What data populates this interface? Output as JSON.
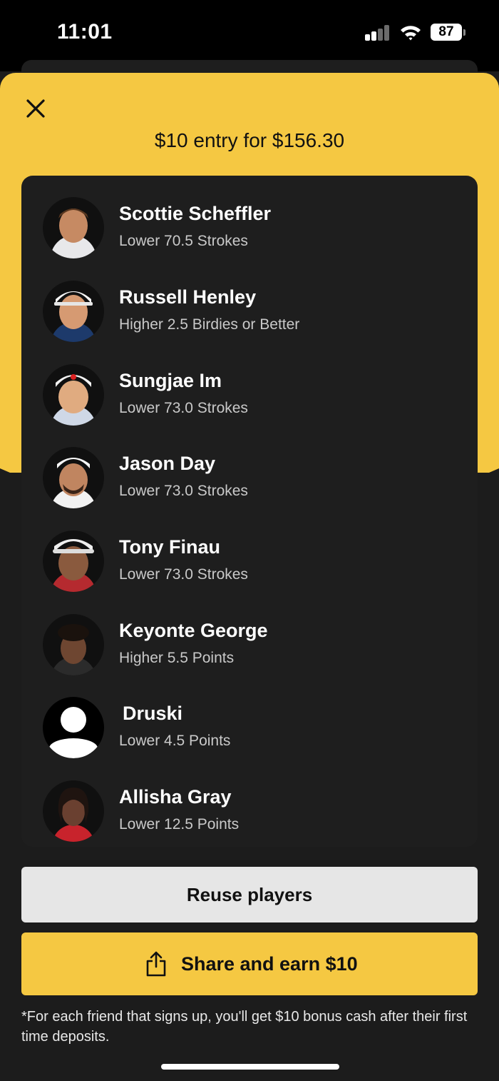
{
  "status_bar": {
    "time": "11:01",
    "battery": "87"
  },
  "sheet": {
    "title": "$10 entry for $156.30"
  },
  "picks": [
    {
      "player": "Scottie Scheffler",
      "line": "Lower 70.5 Strokes",
      "avatar_icon": "player-photo-icon"
    },
    {
      "player": "Russell Henley",
      "line": "Higher 2.5 Birdies or Better",
      "avatar_icon": "player-photo-icon"
    },
    {
      "player": "Sungjae Im",
      "line": "Lower 73.0 Strokes",
      "avatar_icon": "player-photo-icon"
    },
    {
      "player": "Jason Day",
      "line": "Lower 73.0 Strokes",
      "avatar_icon": "player-photo-icon"
    },
    {
      "player": "Tony Finau",
      "line": "Lower 73.0 Strokes",
      "avatar_icon": "player-photo-icon"
    },
    {
      "player": "Keyonte George",
      "line": "Higher 5.5 Points",
      "avatar_icon": "player-photo-icon"
    },
    {
      "player": "Druski",
      "line": "Lower 4.5 Points",
      "avatar_icon": "placeholder-person-icon"
    },
    {
      "player": "Allisha Gray",
      "line": "Lower 12.5 Points",
      "avatar_icon": "player-photo-icon"
    }
  ],
  "actions": {
    "reuse_label": "Reuse players",
    "share_label": "Share and earn $10"
  },
  "footnote": "*For each friend that signs up, you'll get $10 bonus cash after their first time deposits.",
  "colors": {
    "accent": "#f5c842",
    "panel": "#1e1e1e",
    "background": "#1c1c1c"
  }
}
